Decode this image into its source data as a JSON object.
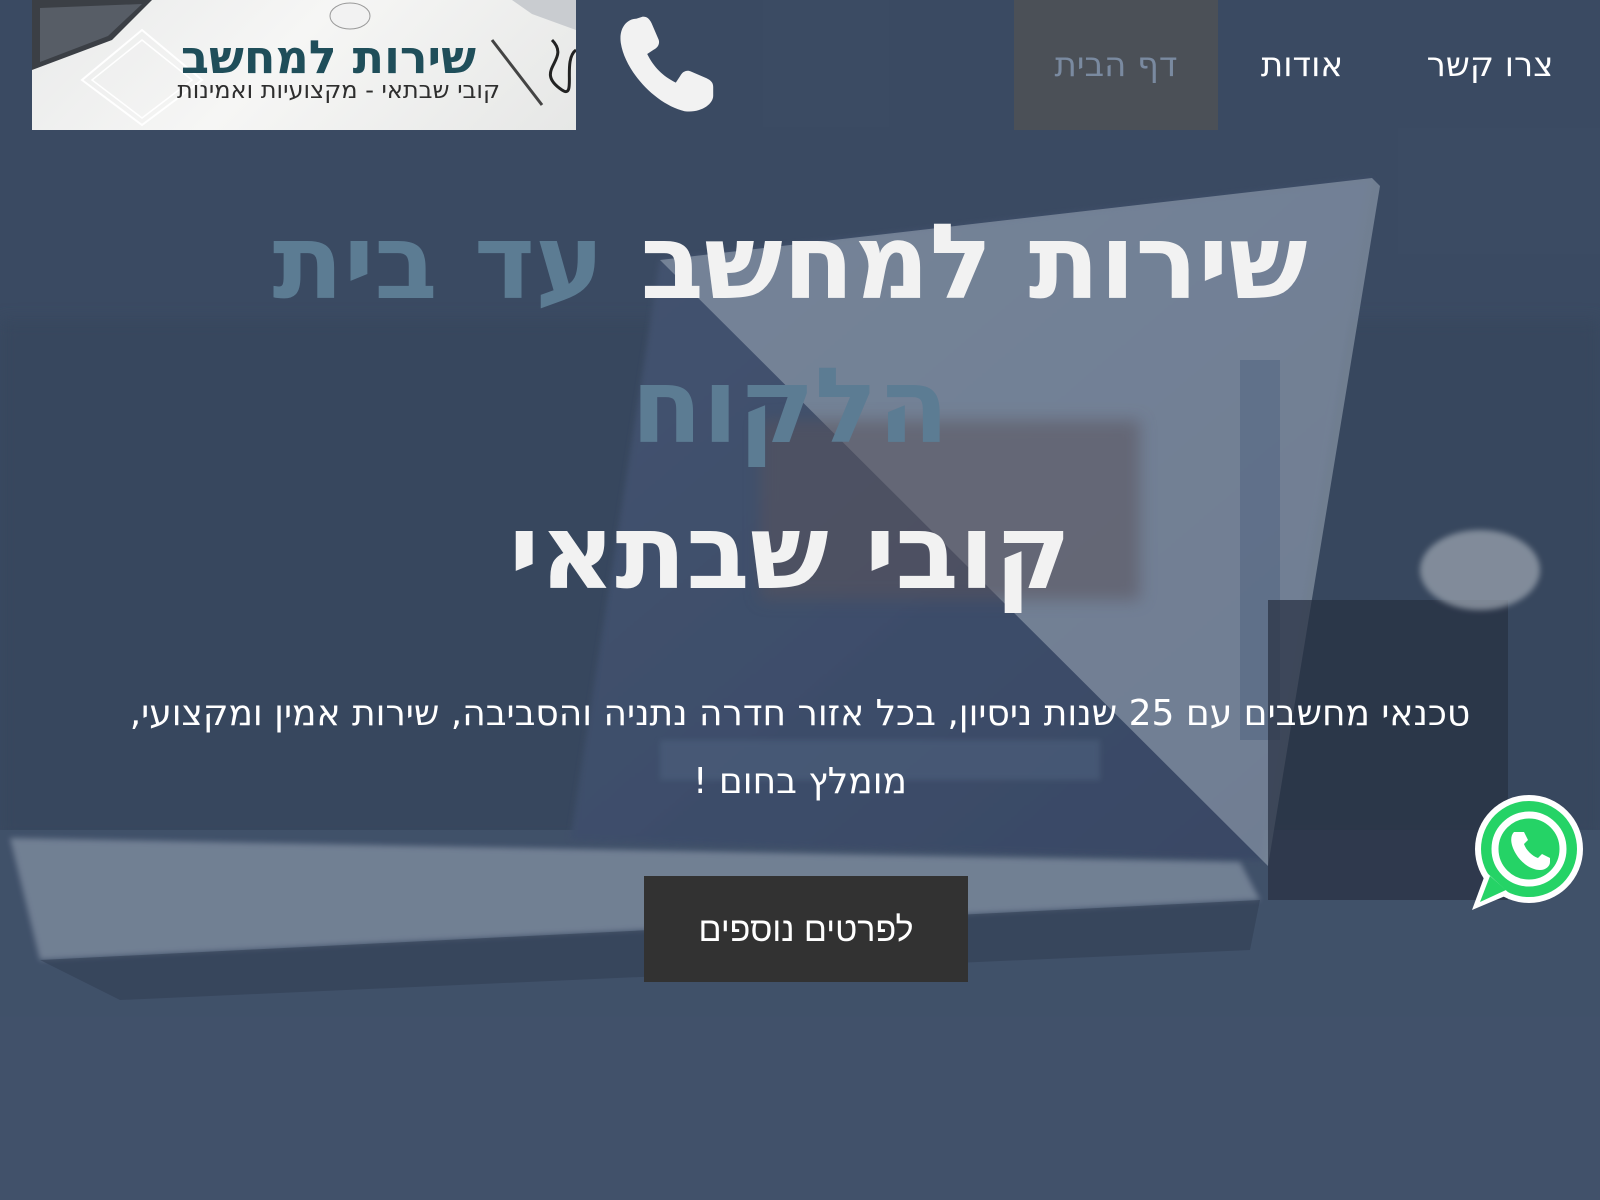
{
  "header": {
    "logo": {
      "title": "שירות למחשב",
      "subtitle": "קובי שבתאי - מקצועיות ואמינות"
    },
    "phone_icon": "phone-icon",
    "nav": {
      "home": "דף הבית",
      "about": "אודות",
      "contact": "צרו קשר"
    }
  },
  "hero": {
    "title_main": "שירות למחשב",
    "title_accent": "עד בית הלקוח",
    "name": "קובי שבתאי",
    "description": "טכנאי מחשבים עם 25 שנות ניסיון, בכל אזור חדרה נתניה והסביבה, שירות אמין ומקצועי, מומלץ בחום !",
    "cta_label": "לפרטים נוספים"
  },
  "floating": {
    "whatsapp_icon": "whatsapp-icon"
  },
  "colors": {
    "accent": "#5c7c93",
    "logo_title": "#1f4e5a",
    "nav_active_bg": "#4b5057",
    "cta_bg": "#323232",
    "whatsapp": "#25d366"
  }
}
